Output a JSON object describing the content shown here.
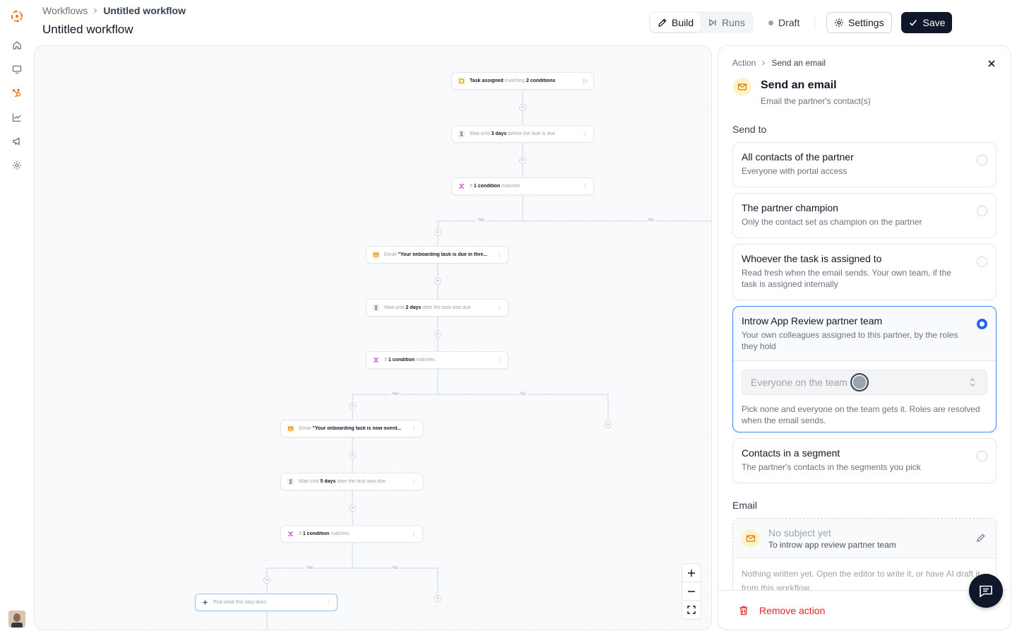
{
  "header": {
    "breadcrumb_root": "Workflows",
    "breadcrumb_current": "Untitled workflow",
    "title": "Untitled workflow",
    "tabs": [
      {
        "label": "Build",
        "active": true
      },
      {
        "label": "Runs",
        "active": false
      }
    ],
    "status": "Draft",
    "settings_label": "Settings",
    "save_label": "Save"
  },
  "rail": {
    "items": [
      "home-icon",
      "monitor-icon",
      "hubspot-icon",
      "chart-icon",
      "megaphone-icon",
      "gear-icon"
    ]
  },
  "canvas": {
    "nodes": [
      {
        "kind": "trigger",
        "text": "Task assigned",
        "mid": " matching ",
        "bold": "2 conditions",
        "end": ""
      },
      {
        "kind": "wait",
        "text": "Wait until ",
        "bold": "3 days",
        "end": " before the task is due"
      },
      {
        "kind": "branch",
        "text": "If ",
        "bold": "1 condition",
        "end": " matches"
      },
      {
        "kind": "email",
        "text": "Email ",
        "bold": "\"Your onboarding task is due in thre...",
        "end": ""
      },
      {
        "kind": "wait",
        "text": "Wait until ",
        "bold": "2 days",
        "end": " after the task was due"
      },
      {
        "kind": "branch",
        "text": "If ",
        "bold": "1 condition",
        "end": " matches"
      },
      {
        "kind": "email",
        "text": "Email ",
        "bold": "\"Your onboarding task is now overd...",
        "end": ""
      },
      {
        "kind": "wait",
        "text": "Wait until ",
        "bold": "5 days",
        "end": " after the task was due"
      },
      {
        "kind": "branch",
        "text": "If ",
        "bold": "1 condition",
        "end": " matches"
      },
      {
        "kind": "empty",
        "text": "Pick what this step does",
        "bold": "",
        "end": ""
      }
    ],
    "branch_yes": "Yes",
    "branch_no": "No"
  },
  "panel": {
    "crumb_root": "Action",
    "crumb_current": "Send an email",
    "title": "Send an email",
    "subtitle": "Email the partner's contact(s)",
    "send_to_label": "Send to",
    "options": [
      {
        "title": "All contacts of the partner",
        "desc": "Everyone with portal access",
        "selected": false
      },
      {
        "title": "The partner champion",
        "desc": "Only the contact set as champion on the partner",
        "selected": false
      },
      {
        "title": "Whoever the task is assigned to",
        "desc": "Read fresh when the email sends. Your own team, if the task is assigned internally",
        "selected": false
      },
      {
        "title": "Introw App Review partner team",
        "desc": "Your own colleagues assigned to this partner, by the roles they hold",
        "selected": true
      },
      {
        "title": "Contacts in a segment",
        "desc": "The partner's contacts in the segments you pick",
        "selected": false
      }
    ],
    "roles_select_placeholder": "Everyone on the team",
    "roles_hint": "Pick none and everyone on the team gets it. Roles are resolved when the email sends.",
    "email_label": "Email",
    "email_subject": "No subject yet",
    "email_to": "To introw app review partner team",
    "email_body": "Nothing written yet. Open the editor to write it, or have AI draft it from this workflow.",
    "remove_label": "Remove action"
  }
}
